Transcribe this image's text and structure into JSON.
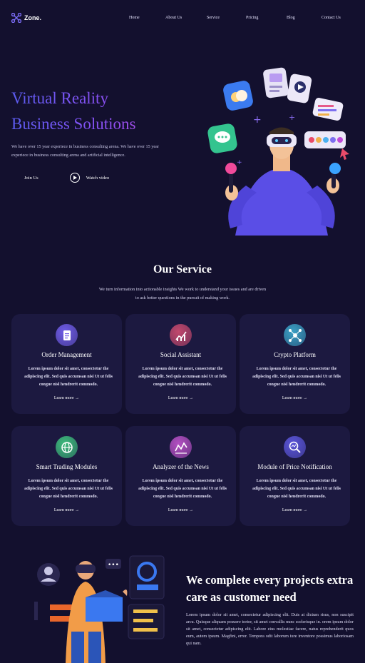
{
  "nav": {
    "brand": "Zone.",
    "links": [
      "Home",
      "About Us",
      "Service",
      "Pricing",
      "Blog",
      "Contact Us"
    ]
  },
  "hero": {
    "title_line1": "Virtual Reality",
    "title_line2": "Business Solutions",
    "description": "We have over 15 year experiece in business consulting arena. We have over 15 year experiece in business consulting arena and artificial intelligence.",
    "join_label": "Join Us",
    "watch_label": "Watch video"
  },
  "services": {
    "title": "Our Service",
    "subtitle": "We turn information into actionable insights We work to understand your issues and are driven to ask better questions in the pursuit of making work.",
    "cards": [
      {
        "title": "Order Management",
        "text": "Lorem ipsum dolor sit amet, consectetur the adipiscing elit. Sed quis accumsan nisi Ut ut felis congue nisl hendrerit commodo.",
        "more": "Learn more",
        "icon": "clipboard-icon",
        "color": "#6f5ce6"
      },
      {
        "title": "Social Assistant",
        "text": "Lorem ipsum dolor sit amet, consectetur the adipiscing elit. Sed quis accumsan nisi Ut ut felis congue nisl hendrerit commodo.",
        "more": "Learn more",
        "icon": "chart-growth-icon",
        "color": "#c2486d"
      },
      {
        "title": "Crypto Platform",
        "text": "Lorem ipsum dolor sit amet, consectetur the adipiscing elit. Sed quis accumsan nisi Ut ut felis congue nisl hendrerit commodo.",
        "more": "Learn more",
        "icon": "network-icon",
        "color": "#3a9fc4"
      },
      {
        "title": "Smart Trading Modules",
        "text": "Lorem ipsum dolor sit amet, consectetur the adipiscing elit. Sed quis accumsan nisi Ut ut felis congue nisl hendrerit commodo.",
        "more": "Learn more",
        "icon": "globe-icon",
        "color": "#3dbb7c"
      },
      {
        "title": "Analyzer of the News",
        "text": "Lorem ipsum dolor sit amet, consectetur the adipiscing elit. Sed quis accumsan nisi Ut ut felis congue nisl hendrerit commodo.",
        "more": "Learn more",
        "icon": "analytics-icon",
        "color": "#b34fc2"
      },
      {
        "title": "Module of Price Notification",
        "text": "Lorem ipsum dolor sit amet, consectetur the adipiscing elit. Sed quis accumsan nisi Ut ut felis congue nisl hendrerit commodo.",
        "more": "Learn more",
        "icon": "search-analytics-icon",
        "color": "#5a55d8"
      }
    ]
  },
  "about": {
    "title": "We complete every projects extra care as customer need",
    "text": "Lorem ipsum dolor sit amet, consectetur adipiscing elit. Duis at dictum risus, non suscipit arcu. Quisque aliquam posuere tortor, sit amet convallis nunc scelerisque in. orem ipsum dolor sit amet, consectetur adipiscing elit. Labore eius molestiae facere, natus reprehenderit quos eum, autem ipsum. Magfini, error. Tempora odit laborum iure inventore possimus laboriosam qui nam."
  }
}
